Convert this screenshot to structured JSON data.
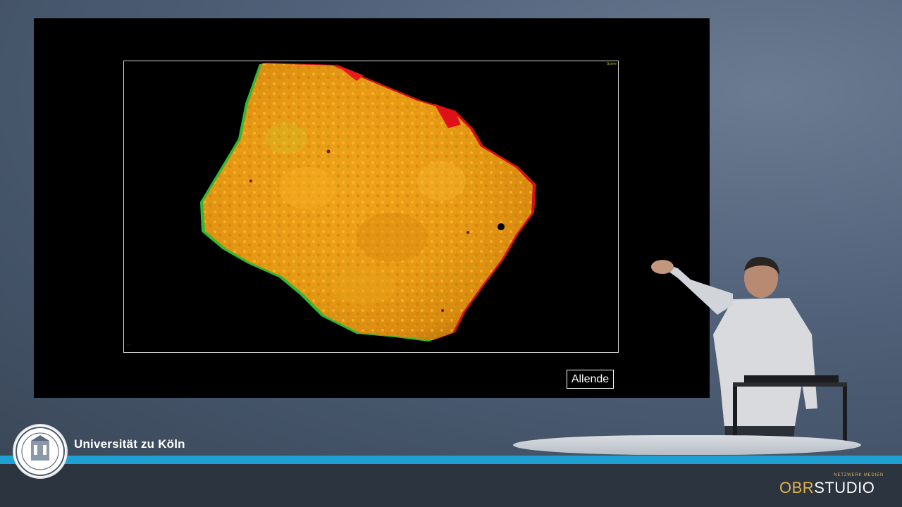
{
  "slide": {
    "viewport_label": "Scene",
    "caption": "Allende"
  },
  "branding": {
    "university": "Universität zu Köln",
    "studio_prefix": "OBR",
    "studio_suffix": "STUDIO",
    "studio_tag": "NETZWERK MEDIEN",
    "accent_color": "#1ea0d2",
    "studio_gold": "#e3b44a"
  },
  "icons": [
    "university-seal-icon",
    "obr-studio-logo"
  ]
}
